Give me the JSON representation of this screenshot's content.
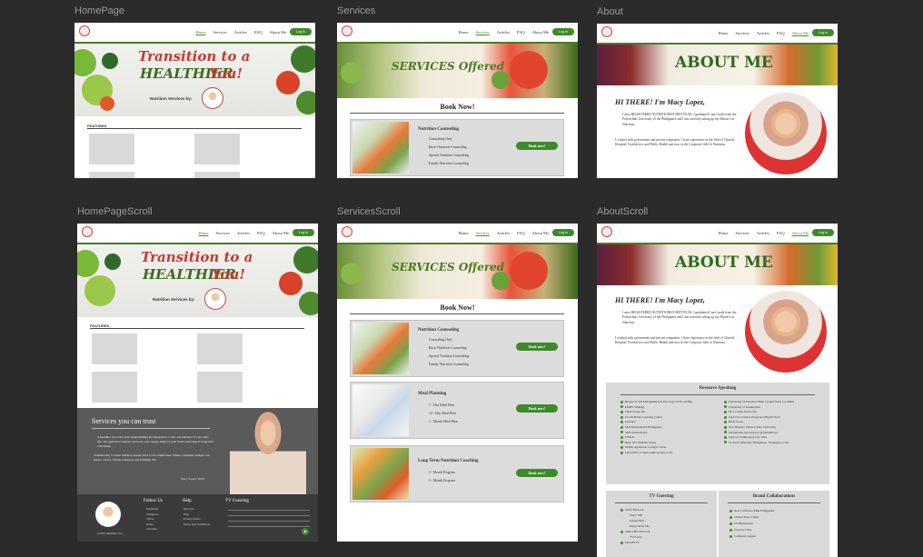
{
  "frames": {
    "home": "HomePage",
    "services": "Services",
    "about": "About",
    "home_scroll": "HomePageScroll",
    "services_scroll": "ServicesScroll",
    "about_scroll": "AboutScroll"
  },
  "nav": {
    "home": "Home",
    "services": "Services",
    "articles": "Articles",
    "faq": "FAQ",
    "about": "About Me",
    "login": "Log In"
  },
  "home": {
    "title_line1": "Transition to a",
    "title_word": "HEALTHIER",
    "title_you": "You!",
    "nutrition_by": "Nutrition Services by:",
    "featured": "FEATURED"
  },
  "services": {
    "banner": "SERVICES Offered",
    "book_now": "Book Now!",
    "counseling": {
      "title": "Nutrition Counseling",
      "items": [
        "Counseling Only",
        "Basic Nutrition Counseling",
        "Special Nutrition Counseling",
        "Family Nutrition Counseling"
      ]
    },
    "meal": {
      "title": "Meal Planning",
      "items": [
        "7 - Day Meal Plan",
        "14 - Day Meal Plan",
        "1 - Month Meal Plan"
      ]
    },
    "longterm": {
      "title": "Long Term Nutrition Coaching",
      "items": [
        "3 - Month Program",
        "5 - Month Program"
      ]
    },
    "book_btn": "Book now!"
  },
  "about": {
    "banner": "ABOUT ME",
    "greeting": "HI THERE!  I'm Macy Lopez,",
    "para1": "I am a REGISTERED NUTRITIONIST-DIETITIAN, I graduated Cum Laude from the Polytechnic University of the Philippines and I am currently taking up my Master's in Nutrition.",
    "para2": "I worked with government and private companies. I have experience in the field of Clinical, Hospital, Foodservice and Public Health and now in the Corporate field of Nutrition.",
    "resource": "Resource Speaking",
    "res_left": [
      "Bureau of Jail Management & Penology NCR and BQ",
      "DOHS Sibhang",
      "Vibal Group Inc.",
      "Earl & Balita Learning Center",
      "Personix",
      "Max International Philippines",
      "SDS International",
      "Fitbuda",
      "Brgy 183 Villamor Pasay",
      "Emilio Aguinaldo College Cavite",
      "University of Saint Anthony Iriga City"
    ],
    "res_right": [
      "University of Perpetual Help System Dalta Las Piñas",
      "University of Assumption",
      "De La Salle University",
      "Lipa City Science Integrated High School",
      "RNS Luzon",
      "Don Honorio Ventura State University",
      "Pamantasan ng Lungsod ng Muntinlupa",
      "Intervet, Zamboanga City West",
      "St. Paul University Philippines, Tuguegarao City"
    ],
    "tv": "TV Guesting",
    "tv_items": [
      "GMA Network",
      "Pinoy MD",
      "Unang Hirit",
      "Dapat Alam Mo",
      "ABS-CBN Network",
      "TV Patrol",
      "One PH TV"
    ],
    "brand": "Brand Collaborations",
    "brand_items": [
      "Real California Milk Philippines",
      "Chapen Keto Cubes",
      "US Blueberries",
      "Potatoes USA",
      "California Grapes"
    ]
  },
  "home_scroll": {
    "trust_title": "Services you can trust",
    "trust_p1": "A healthier you starts with understanding the importance of diet and nutrition in your daily life. The right food choices can boost your energy, improve your mood, and support long-term well-being.",
    "trust_p2": "Transitioning to better nutrition doesn't have to be complicated. Small, consistent changes can lead to a more vibrant, balanced, and fulfilling life.",
    "sign": "Macy Lopez, RND",
    "follow": "Follow Us",
    "follow_items": [
      "Facebook",
      "Instagram",
      "TikTok",
      "Email",
      "YouTube"
    ],
    "help": "Help",
    "help_items": [
      "Services",
      "FAQ",
      "Privacy Policy",
      "Terms and Conditions"
    ],
    "tvg": "TV Guesting",
    "copyright": "©2024 Healthier You."
  },
  "colors": {
    "accent_green": "#3d8a2a",
    "title_red": "#c9382e",
    "dark_bg": "#2b2b2b"
  }
}
